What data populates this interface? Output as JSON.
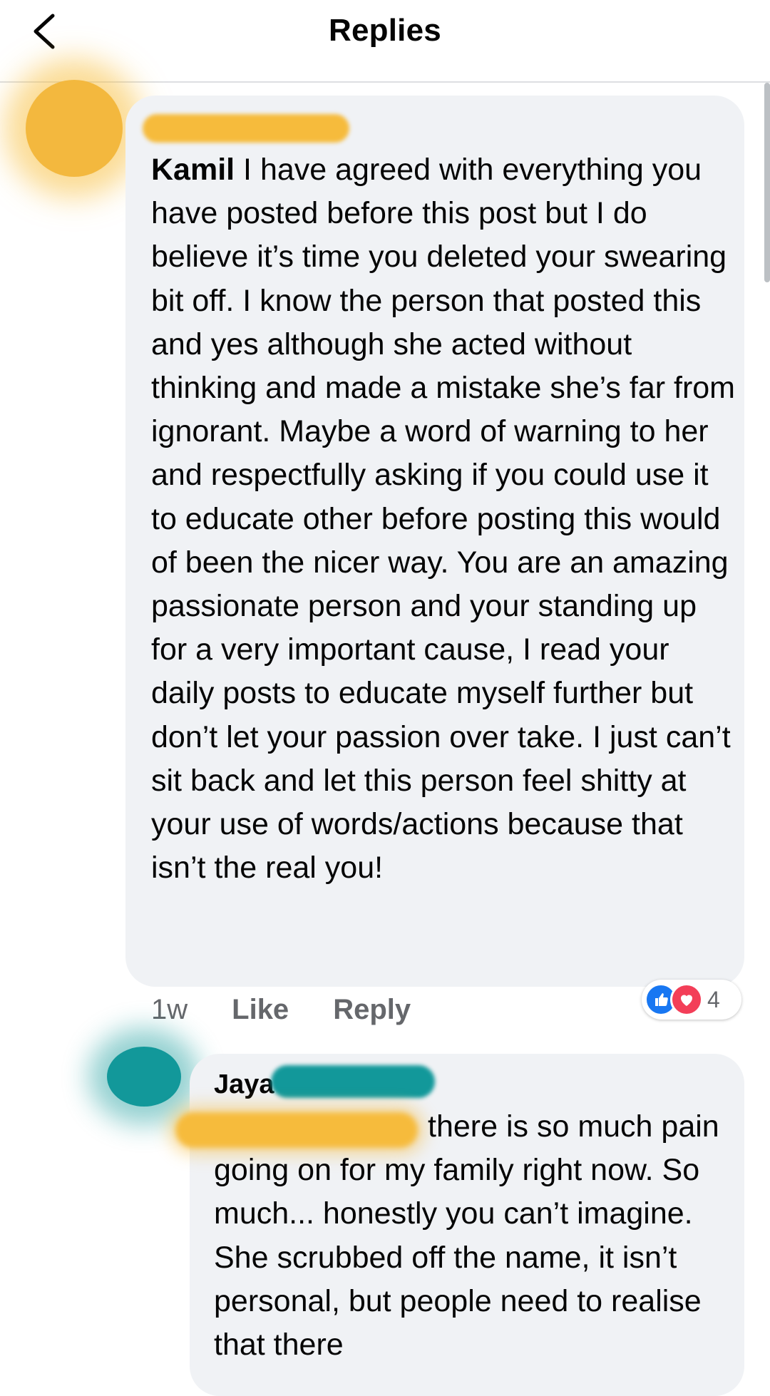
{
  "header": {
    "title": "Replies",
    "back_icon": "chevron-left-icon"
  },
  "comments": [
    {
      "author": "Kamil",
      "text": " I have agreed with everything you have posted before this post but I do believe it’s time you deleted your swearing bit off. I know the person that posted this and yes although she acted without thinking and made a mistake she’s far from ignorant. Maybe a word of warning to her and respectfully asking if you could use it to educate other before posting this would of been the nicer way. You are an amazing passionate person and your standing up for a very important cause, I read your daily posts to educate myself further but don’t let your passion over take. I just can’t sit back and let this person feel shitty at your use of words/actions because that isn’t the real you!",
      "time": "1w",
      "like_label": "Like",
      "reply_label": "Reply",
      "reaction_count": "4",
      "reaction_icons": [
        "like-reaction-icon",
        "love-reaction-icon"
      ]
    },
    {
      "author": "Jaya",
      "text": "there is so much pain going on for my family right now. So much... honestly you can’t imagine. She scrubbed off the name, it isn’t personal, but people need to realise that there"
    }
  ],
  "colors": {
    "bubble": "#f0f2f5",
    "meta_text": "#65676b",
    "like_blue": "#1877f2",
    "love_red": "#f33e58",
    "redaction_yellow": "#f6bb3c",
    "redaction_teal": "#12989a"
  }
}
